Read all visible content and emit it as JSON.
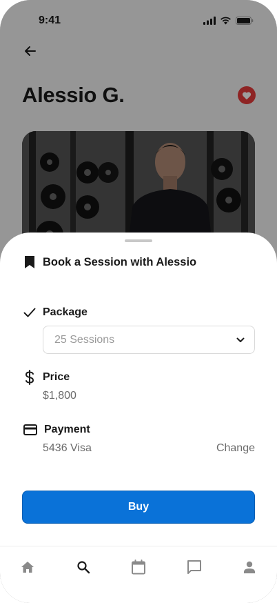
{
  "status_bar": {
    "time": "9:41"
  },
  "profile": {
    "name": "Alessio G."
  },
  "sheet": {
    "title": "Book a Session with Alessio",
    "package": {
      "label": "Package",
      "selected": "25 Sessions"
    },
    "price": {
      "label": "Price",
      "value": "$1,800"
    },
    "payment": {
      "label": "Payment",
      "method": "5436 Visa",
      "change_label": "Change"
    },
    "buy_label": "Buy"
  },
  "tab_bar": {
    "tabs": [
      "home-icon",
      "search-icon",
      "calendar-icon",
      "messages-icon",
      "profile-icon"
    ],
    "active": "search-icon"
  },
  "colors": {
    "accent": "#0a72d8",
    "favorite": "#e53b3b"
  }
}
